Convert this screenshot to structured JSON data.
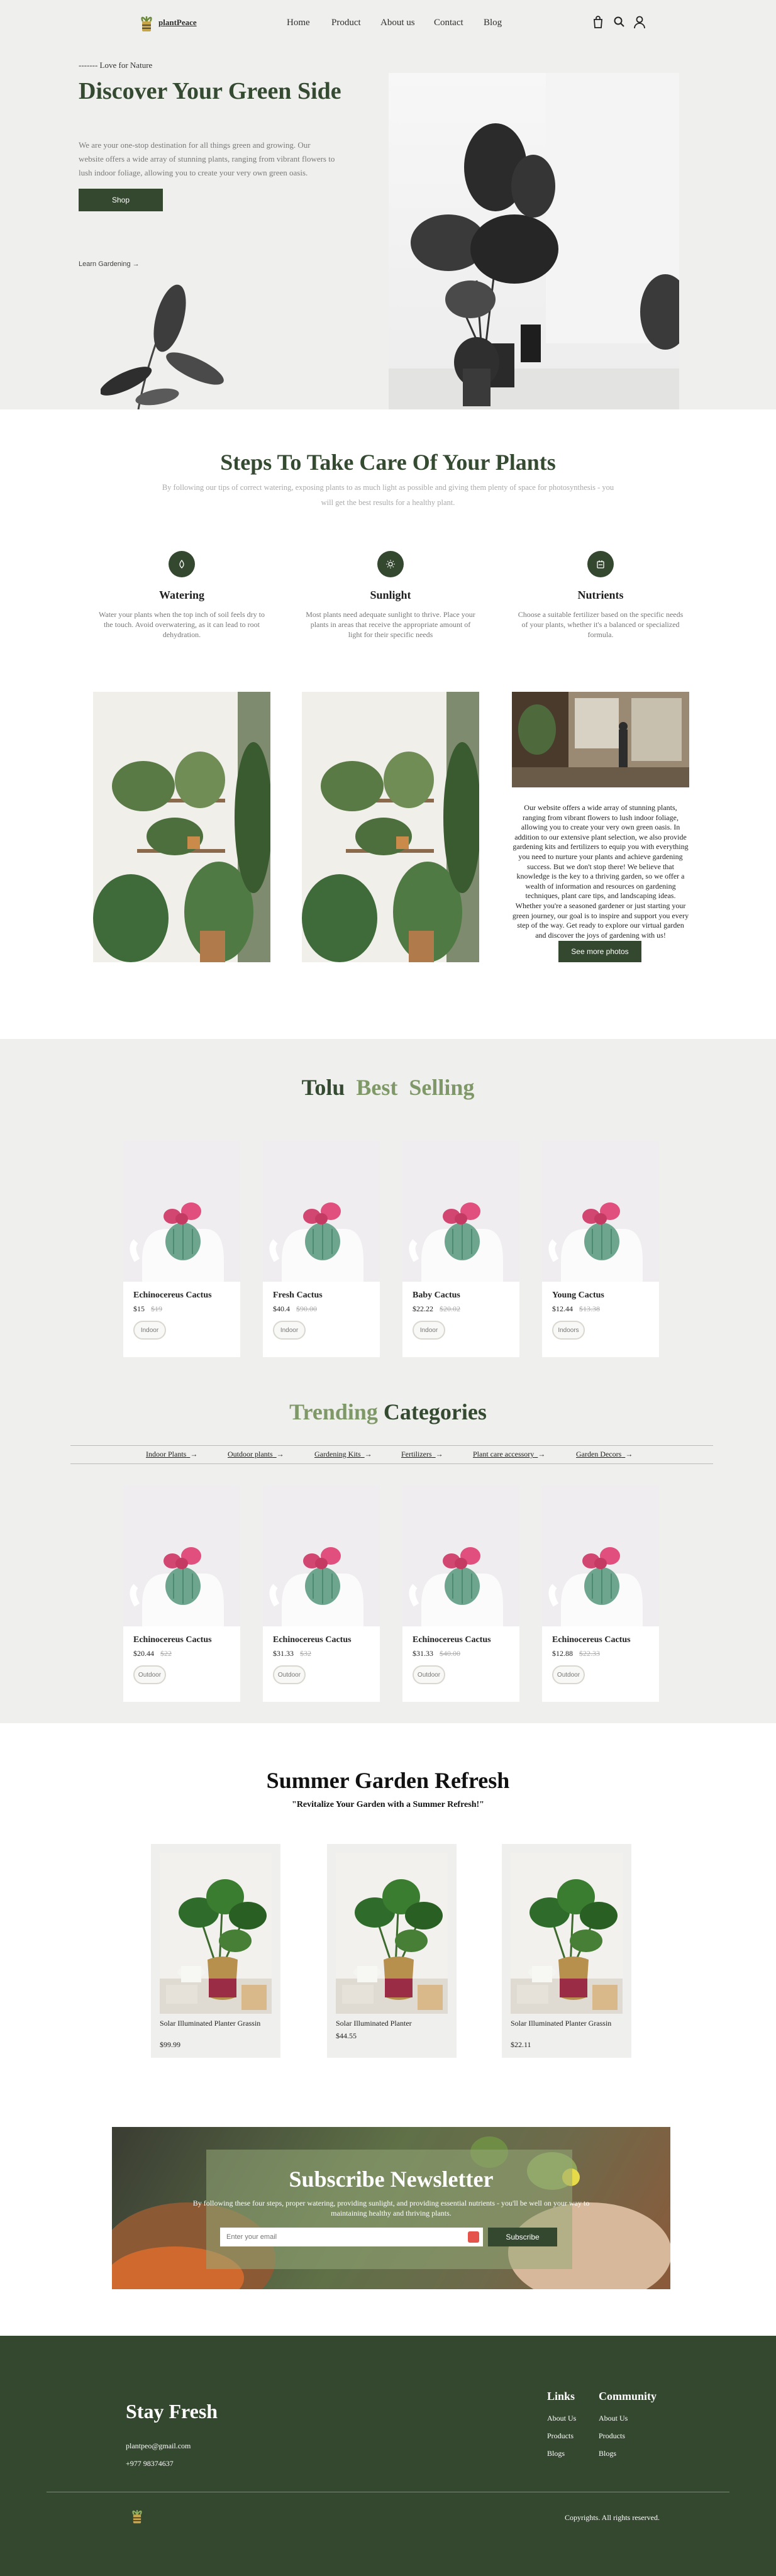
{
  "nav": {
    "logo": "plantPeace",
    "links": [
      "Home",
      "Product",
      "About us",
      "Contact",
      "Blog"
    ],
    "icons": [
      "cart-icon",
      "search-icon",
      "user-icon"
    ]
  },
  "hero": {
    "tagline": "------- Love for Nature",
    "title": "Discover Your Green Side",
    "description": "We are your one-stop destination for all things green and growing. Our website offers a wide array of stunning plants, ranging from vibrant flowers to lush indoor foliage, allowing you to create your very own green oasis.",
    "shop_label": "Shop",
    "learn_label": "Learn Gardening"
  },
  "steps": {
    "title": "Steps To Take Care Of Your Plants",
    "subtitle": "By following our tips of correct watering, exposing plants to as much light as possible and giving them plenty of space for photosynthesis - you will get the best results for a healthy plant.",
    "items": [
      {
        "title": "Watering",
        "desc": "Water your plants when the top inch of soil feels dry to the touch. Avoid overwatering, as it can lead to root dehydration.",
        "icon": "water-drop-icon"
      },
      {
        "title": "Sunlight",
        "desc": "Most plants need adequate sunlight to thrive. Place your plants in areas that receive the appropriate amount of light for their specific needs",
        "icon": "sun-icon"
      },
      {
        "title": "Nutrients",
        "desc": "Choose a suitable fertilizer based on the specific needs of your plants, whether it's a balanced or specialized formula.",
        "icon": "nutrient-icon"
      }
    ],
    "about": "Our website offers a wide array of stunning plants, ranging from vibrant flowers to lush indoor foliage, allowing you to create your very own green oasis. In addition to our extensive plant selection, we also provide gardening kits and fertilizers to equip you with everything you need to nurture your plants and achieve gardening success. But we don't stop there! We believe that knowledge is the key to a thriving garden, so we offer a wealth of information and resources on gardening techniques, plant care tips, and landscaping ideas. Whether you're a seasoned gardener or just starting your green journey, our goal is to inspire and support you every step of the way. Get ready to explore our virtual garden and discover the joys of gardening with us!",
    "see_more": "See more photos"
  },
  "best": {
    "title_parts": [
      "Tolu",
      "Best",
      "Selling"
    ],
    "products": [
      {
        "name": "Echinocereus Cactus",
        "price": "$15",
        "old": "$19",
        "tag": "Indoor"
      },
      {
        "name": "Fresh Cactus",
        "price": "$40.4",
        "old": "$90.00",
        "tag": "Indoor"
      },
      {
        "name": "Baby Cactus",
        "price": "$22.22",
        "old": "$20.02",
        "tag": "Indoor"
      },
      {
        "name": "Young Cactus",
        "price": "$12.44",
        "old": "$13.38",
        "tag": "Indoors"
      }
    ]
  },
  "trending": {
    "title_parts": [
      "Trending",
      "Categories"
    ],
    "categories": [
      "Indoor Plants",
      "Outdoor plants",
      "Gardening Kits",
      "Fertilizers",
      "Plant care accessory",
      "Garden Decors"
    ],
    "products": [
      {
        "name": "Echinocereus Cactus",
        "price": "$20.44",
        "old": "$22",
        "tag": "Outdoor"
      },
      {
        "name": "Echinocereus Cactus",
        "price": "$31.33",
        "old": "$32",
        "tag": "Outdoor"
      },
      {
        "name": "Echinocereus Cactus",
        "price": "$31.33",
        "old": "$40.00",
        "tag": "Outdoor"
      },
      {
        "name": "Echinocereus Cactus",
        "price": "$12.88",
        "old": "$22.33",
        "tag": "Outdoor"
      }
    ]
  },
  "summer": {
    "title": "Summer Garden Refresh",
    "subtitle": "\"Revitalize Your Garden with a Summer Refresh!\"",
    "products": [
      {
        "name": "Solar Illuminated Planter Grassin",
        "price": "$99.99"
      },
      {
        "name": "Solar Illuminated Planter",
        "price": "$44.55"
      },
      {
        "name": "Solar Illuminated Planter Grassin",
        "price": "$22.11"
      }
    ]
  },
  "newsletter": {
    "title": "Subscribe Newsletter",
    "desc": "By following these four steps, proper watering, providing sunlight, and providing essential nutrients - you'll be well on your way to maintaining healthy and thriving plants.",
    "placeholder": "Enter your email",
    "button": "Subscribe"
  },
  "footer": {
    "title": "Stay Fresh",
    "email": "plantpeo@gmail.com",
    "phone": "+977 98374637",
    "links_head": "Links",
    "links": [
      "About Us",
      "Products",
      "Blogs"
    ],
    "community_head": "Community",
    "community": [
      "About Us",
      "Products",
      "Blogs"
    ],
    "copyright": "Copyrights. All rights reserved."
  },
  "colors": {
    "accent": "#34472f",
    "sage": "#7f9867",
    "bg": "#efefed"
  }
}
